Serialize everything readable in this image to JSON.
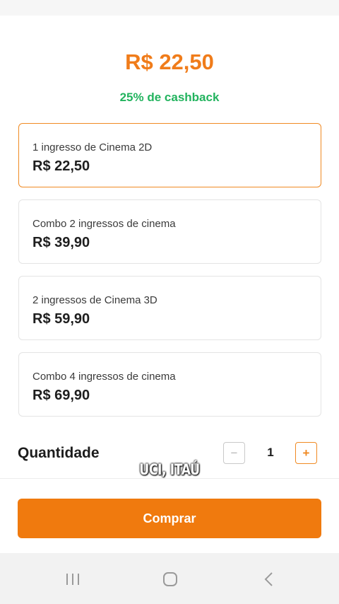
{
  "header": {
    "price": "R$ 22,50",
    "cashback": "25% de cashback"
  },
  "options": [
    {
      "name": "1 ingresso de Cinema 2D",
      "price": "R$ 22,50",
      "selected": true
    },
    {
      "name": "Combo 2 ingressos de cinema",
      "price": "R$ 39,90",
      "selected": false
    },
    {
      "name": "2 ingressos de Cinema 3D",
      "price": "R$ 59,90",
      "selected": false
    },
    {
      "name": "Combo 4 ingressos de cinema",
      "price": "R$ 69,90",
      "selected": false
    }
  ],
  "quantity": {
    "label": "Quantidade",
    "value": "1",
    "minus": "−",
    "plus": "+"
  },
  "buy_button": "Comprar",
  "caption": "UCI, ITAÚ",
  "navbar": {
    "icons": [
      "recent-apps-icon",
      "home-icon",
      "back-icon"
    ]
  },
  "colors": {
    "accent": "#f07a0e",
    "cashback": "#22b35e",
    "selected_border": "#f08a23"
  }
}
